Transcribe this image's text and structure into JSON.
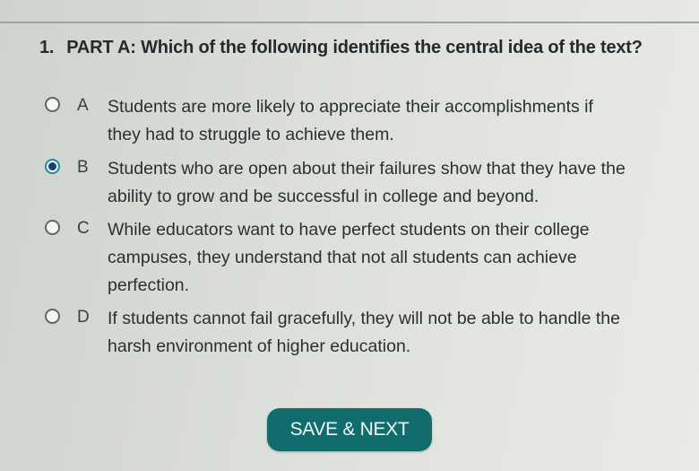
{
  "question": {
    "number": "1.",
    "text": "PART A: Which of the following identifies the central idea of the text?"
  },
  "choices": [
    {
      "letter": "A",
      "line1": "Students are more likely to appreciate their accomplishments if",
      "line2": "they had to struggle to achieve them.",
      "line3": "",
      "selected": false
    },
    {
      "letter": "B",
      "line1": "Students who are open about their failures show that they have the",
      "line2": "ability to grow and be successful in college and beyond.",
      "line3": "",
      "selected": true
    },
    {
      "letter": "C",
      "line1": "While educators want to have perfect students on their college",
      "line2": "campuses, they understand that not all students can achieve",
      "line3": "perfection.",
      "selected": false
    },
    {
      "letter": "D",
      "line1": "If students cannot fail gracefully, they will not be able to handle the",
      "line2": "harsh environment of higher education.",
      "line3": "",
      "selected": false
    }
  ],
  "button": {
    "label": "SAVE & NEXT"
  },
  "colors": {
    "selected_radio": "#1f3c7a",
    "button_bg": "#116d6d"
  }
}
